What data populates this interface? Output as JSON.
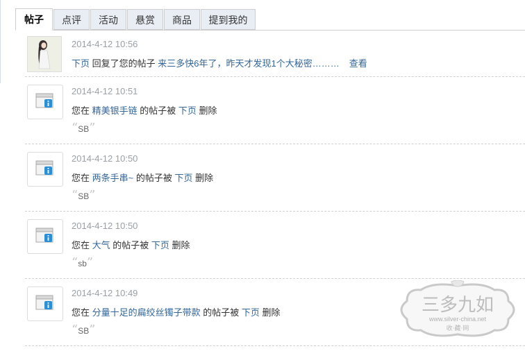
{
  "tabs": [
    {
      "label": "帖子",
      "active": true
    },
    {
      "label": "点评",
      "active": false
    },
    {
      "label": "活动",
      "active": false
    },
    {
      "label": "悬赏",
      "active": false
    },
    {
      "label": "商品",
      "active": false
    },
    {
      "label": "提到我的",
      "active": false
    }
  ],
  "notifications": [
    {
      "time": "2014-4-12 10:56",
      "user": "下页",
      "text1": " 回复了您的帖子 ",
      "post": "来三多快6年了，昨天才发现1个大秘密………",
      "view": "查看"
    },
    {
      "time": "2014-4-12 10:51",
      "prefix": "您在 ",
      "post": "精美银手链",
      "mid": " 的帖子被 ",
      "user": "下页",
      "action": " 删除",
      "reason": "SB"
    },
    {
      "time": "2014-4-12 10:50",
      "prefix": "您在 ",
      "post": "两条手串~",
      "mid": " 的帖子被 ",
      "user": "下页",
      "action": " 删除",
      "reason": "SB"
    },
    {
      "time": "2014-4-12 10:50",
      "prefix": "您在 ",
      "post": "大气",
      "mid": " 的帖子被 ",
      "user": "下页",
      "action": " 删除",
      "reason": "sb"
    },
    {
      "time": "2014-4-12 10:49",
      "prefix": "您在 ",
      "post": "分量十足的扁绞丝镯子带款",
      "mid": " 的帖子被 ",
      "user": "下页",
      "action": " 删除",
      "reason": "SB"
    }
  ],
  "watermark": {
    "name": "三多九如",
    "site": "www.silver-china.net",
    "sub": "收·藏·网"
  },
  "colors": {
    "link": "#336699",
    "time": "#9aa0a6",
    "tab_bg": "#e8eef4",
    "info_blue": "#2b8fd8"
  }
}
